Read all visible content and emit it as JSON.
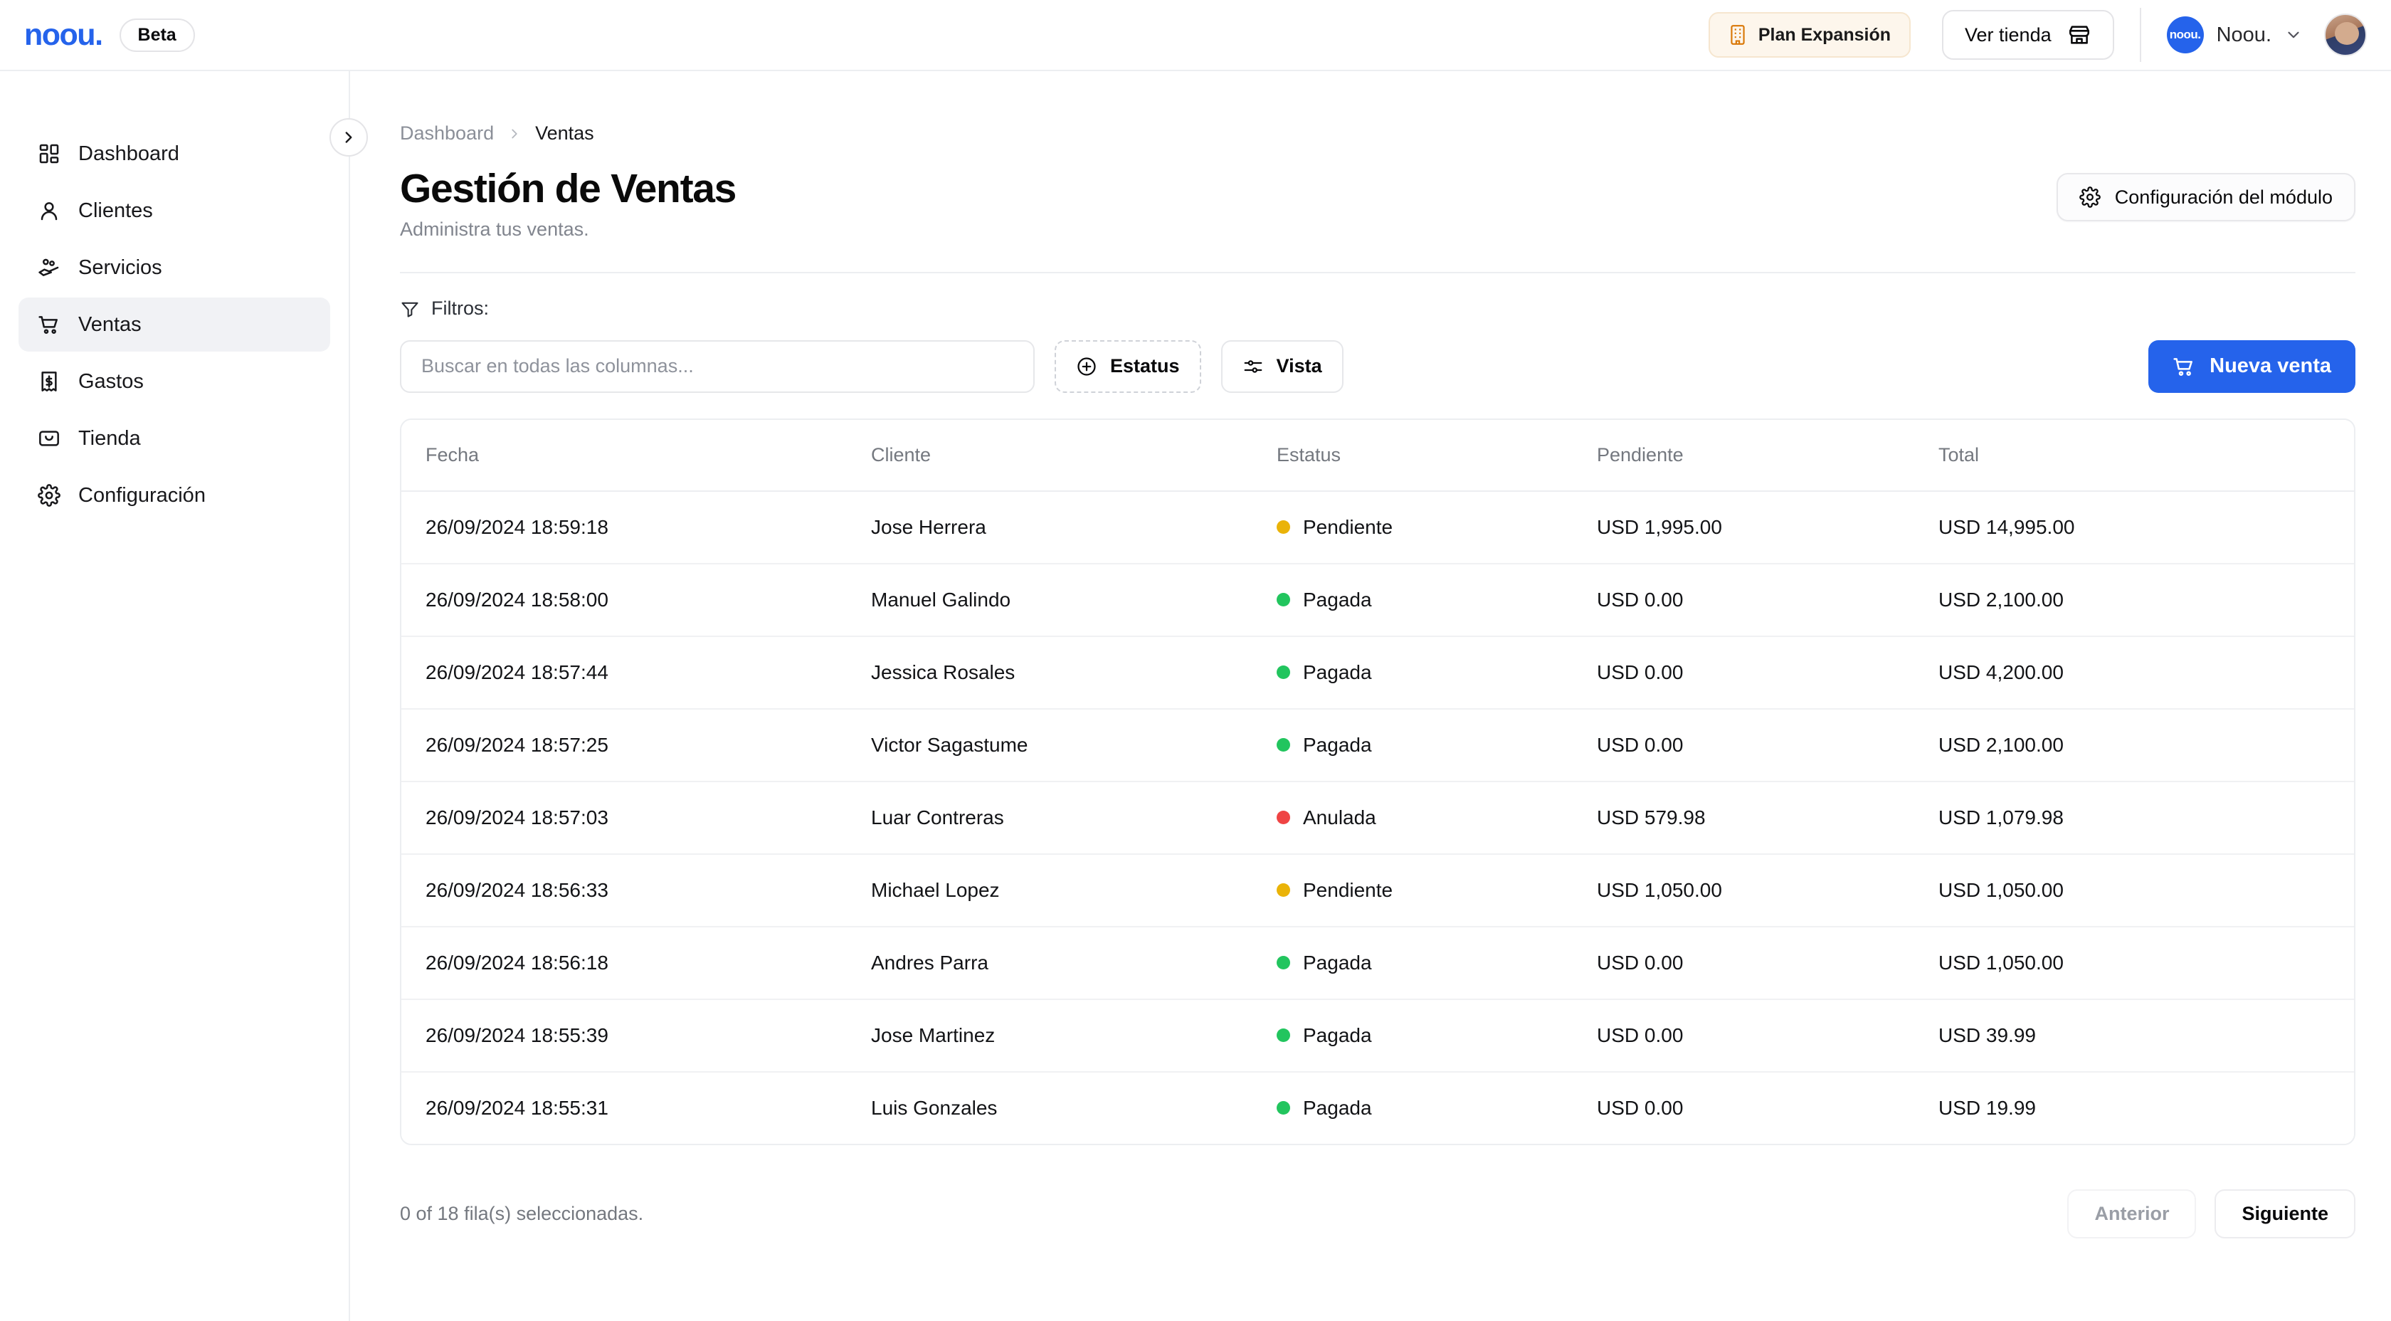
{
  "brand": {
    "logo_text": "noou.",
    "logo_color": "#2563eb",
    "logo_dot_color": "#f59e0b",
    "beta_label": "Beta"
  },
  "topbar": {
    "plan_badge": {
      "label": "Plan Expansión",
      "icon": "building-icon",
      "accent": "#d97706",
      "background": "#fdf6ec"
    },
    "store_button": {
      "label": "Ver tienda",
      "icon": "storefront-icon"
    },
    "account": {
      "logo_text": "noou.",
      "name": "Noou.",
      "chevron": "chevron-down-icon"
    }
  },
  "sidebar": {
    "collapse_icon": "chevron-right-icon",
    "items": [
      {
        "label": "Dashboard",
        "icon": "grid-icon",
        "active": false
      },
      {
        "label": "Clientes",
        "icon": "user-icon",
        "active": false
      },
      {
        "label": "Servicios",
        "icon": "handshake-icon",
        "active": false
      },
      {
        "label": "Ventas",
        "icon": "cart-icon",
        "active": true
      },
      {
        "label": "Gastos",
        "icon": "receipt-icon",
        "active": false
      },
      {
        "label": "Tienda",
        "icon": "shopping-bag-icon",
        "active": false
      },
      {
        "label": "Configuración",
        "icon": "gear-icon",
        "active": false
      }
    ]
  },
  "breadcrumb": {
    "parent": "Dashboard",
    "separator": "›",
    "current": "Ventas"
  },
  "page": {
    "title": "Gestión de Ventas",
    "subtitle": "Administra tus ventas.",
    "module_config_button": {
      "label": "Configuración del módulo",
      "icon": "gear-icon"
    }
  },
  "filters": {
    "label": "Filtros:",
    "icon": "funnel-icon",
    "search": {
      "value": "",
      "placeholder": "Buscar en todas las columnas..."
    },
    "estatus_button": {
      "label": "Estatus",
      "icon": "plus-circle-icon"
    },
    "vista_button": {
      "label": "Vista",
      "icon": "sliders-icon"
    },
    "new_sale_button": {
      "label": "Nueva venta",
      "icon": "cart-icon",
      "color": "#2563eb"
    }
  },
  "table": {
    "columns": [
      "Fecha",
      "Cliente",
      "Estatus",
      "Pendiente",
      "Total"
    ],
    "status_colors": {
      "Pendiente": "#eab308",
      "Pagada": "#22c55e",
      "Anulada": "#ef4444"
    },
    "rows": [
      {
        "fecha": "26/09/2024 18:59:18",
        "cliente": "Jose Herrera",
        "estatus": "Pendiente",
        "pendiente": "USD 1,995.00",
        "total": "USD 14,995.00"
      },
      {
        "fecha": "26/09/2024 18:58:00",
        "cliente": "Manuel Galindo",
        "estatus": "Pagada",
        "pendiente": "USD 0.00",
        "total": "USD 2,100.00"
      },
      {
        "fecha": "26/09/2024 18:57:44",
        "cliente": "Jessica Rosales",
        "estatus": "Pagada",
        "pendiente": "USD 0.00",
        "total": "USD 4,200.00"
      },
      {
        "fecha": "26/09/2024 18:57:25",
        "cliente": "Victor Sagastume",
        "estatus": "Pagada",
        "pendiente": "USD 0.00",
        "total": "USD 2,100.00"
      },
      {
        "fecha": "26/09/2024 18:57:03",
        "cliente": "Luar Contreras",
        "estatus": "Anulada",
        "pendiente": "USD 579.98",
        "total": "USD 1,079.98"
      },
      {
        "fecha": "26/09/2024 18:56:33",
        "cliente": "Michael Lopez",
        "estatus": "Pendiente",
        "pendiente": "USD 1,050.00",
        "total": "USD 1,050.00"
      },
      {
        "fecha": "26/09/2024 18:56:18",
        "cliente": "Andres Parra",
        "estatus": "Pagada",
        "pendiente": "USD 0.00",
        "total": "USD 1,050.00"
      },
      {
        "fecha": "26/09/2024 18:55:39",
        "cliente": "Jose Martinez",
        "estatus": "Pagada",
        "pendiente": "USD 0.00",
        "total": "USD 39.99"
      },
      {
        "fecha": "26/09/2024 18:55:31",
        "cliente": "Luis Gonzales",
        "estatus": "Pagada",
        "pendiente": "USD 0.00",
        "total": "USD 19.99"
      }
    ]
  },
  "footer": {
    "selection_text": "0 of 18 fila(s) seleccionadas.",
    "prev_label": "Anterior",
    "next_label": "Siguiente",
    "prev_disabled": true
  }
}
